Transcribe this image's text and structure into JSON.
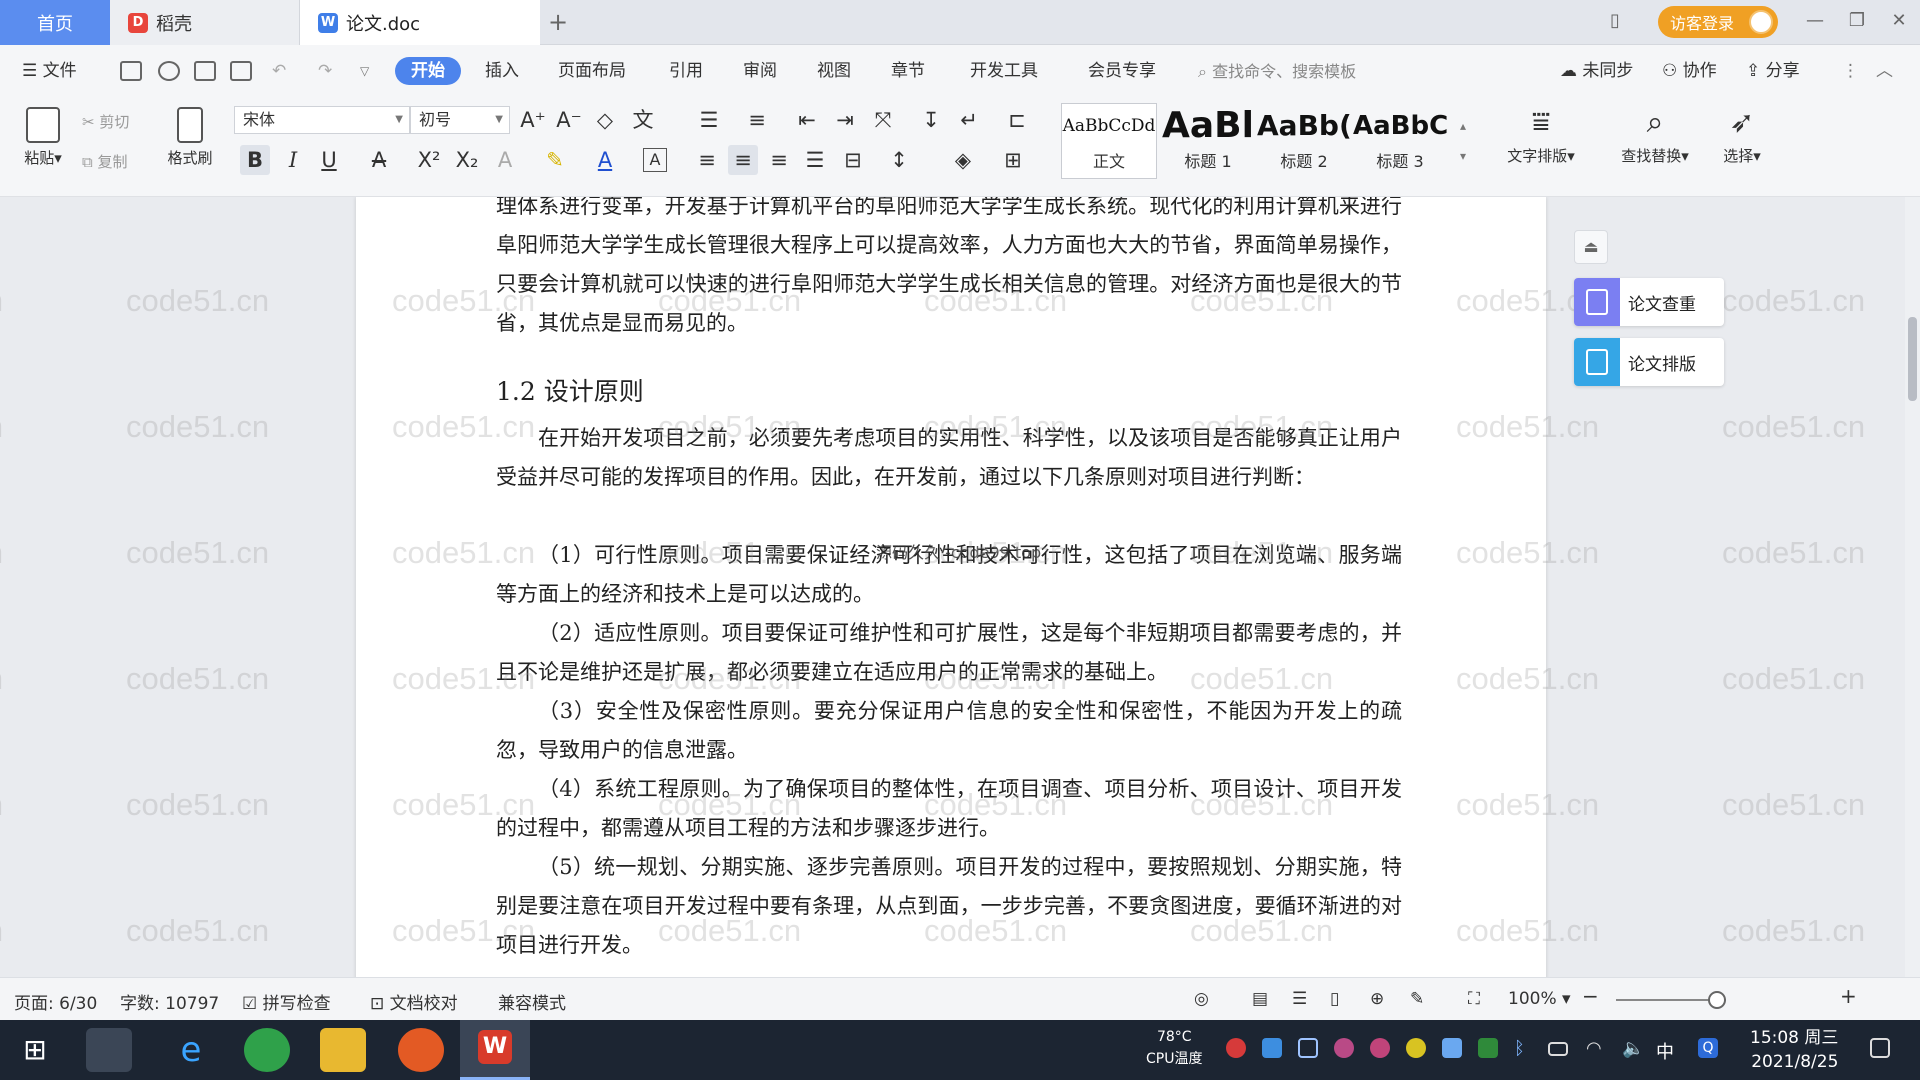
{
  "tabs": {
    "home": "首页",
    "daoke": "稻壳",
    "doc": "论文.doc"
  },
  "topbar": {
    "login_label": "访客登录"
  },
  "menubar": {
    "file": "文件",
    "items": [
      "开始",
      "插入",
      "页面布局",
      "引用",
      "审阅",
      "视图",
      "章节",
      "开发工具",
      "会员专享"
    ],
    "search_placeholder": "查找命令、搜索模板",
    "right": {
      "sync": "未同步",
      "collab": "协作",
      "share": "分享"
    }
  },
  "ribbon": {
    "paste": "粘贴",
    "cut": "剪切",
    "copy": "复制",
    "format_painter": "格式刷",
    "font_name": "宋体",
    "font_size": "初号",
    "styles": [
      {
        "sample": "AaBbCcDd",
        "name": "正文"
      },
      {
        "sample": "AaBl",
        "name": "标题 1"
      },
      {
        "sample": "AaBb(",
        "name": "标题 2"
      },
      {
        "sample": "AaBbC",
        "name": "标题 3"
      }
    ],
    "text_layout": "文字排版",
    "find_replace": "查找替换",
    "select": "选择"
  },
  "document": {
    "p0": "理体系进行变革，开发基于计算机平台的阜阳师范大学学生成长系统。现代化的利用计算机来进行阜阳师范大学学生成长管理很大程序上可以提高效率，人力方面也大大的节省，界面简单易操作，只要会计算机就可以快速的进行阜阳师范大学学生成长相关信息的管理。对经济方面也是很大的节省，其优点是显而易见的。",
    "heading": "1.2 设计原则",
    "p1": "在开始开发项目之前，必须要先考虑项目的实用性、科学性，以及该项目是否能够真正让用户受益并尽可能的发挥项目的作用。因此，在开发前，通过以下几条原则对项目进行判断：",
    "p2": "（1）可行性原则。项目需要保证经济可行性和技术可行性，这包括了项目在浏览端、服务端等方面上的经济和技术上是可以达成的。",
    "p3": "（2）适应性原则。项目要保证可维护性和可扩展性，这是每个非短期项目都需要考虑的，并且不论是维护还是扩展，都必须要建立在适应用户的正常需求的基础上。",
    "p4": "（3）安全性及保密性原则。要充分保证用户信息的安全性和保密性，不能因为开发上的疏忽，导致用户的信息泄露。",
    "p5": "（4）系统工程原则。为了确保项目的整体性，在项目调查、项目分析、项目设计、项目开发的过程中，都需遵从项目工程的方法和步骤逐步进行。",
    "p6": "（5）统一规划、分期实施、逐步完善原则。项目开发的过程中，要按照规划、分期实施，特别是要注意在项目开发过程中要有条理，从点到面，一步步完善，不要贪图进度，要循环渐进的对项目进行开发。",
    "overlay": "源码久久 -code99.top",
    "watermark": "code51.cn"
  },
  "side_panel": {
    "check": "论文查重",
    "layout": "论文排版"
  },
  "statusbar": {
    "page": "页面: 6/30",
    "words": "字数: 10797",
    "spell": "拼写检查",
    "proof": "文档校对",
    "compat": "兼容模式",
    "zoom": "100%"
  },
  "taskbar": {
    "temp": "78°C",
    "cpu": "CPU温度",
    "ime": "中",
    "time": "15:08 周三",
    "date": "2021/8/25"
  },
  "colors": {
    "accent": "#4d84ec",
    "login": "#f0a024",
    "taskbar": "#1c2532"
  }
}
